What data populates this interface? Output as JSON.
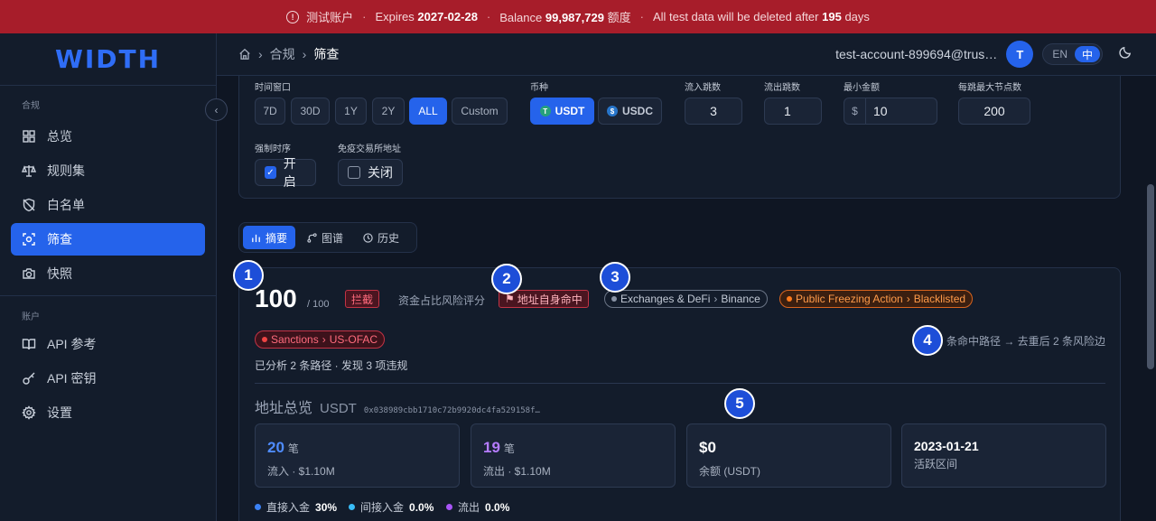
{
  "banner": {
    "account": "测试账户",
    "expires_label": "Expires",
    "expires_date": "2027-02-28",
    "balance_label": "Balance",
    "balance_value": "99,987,729",
    "balance_unit": "额度",
    "notice_prefix": "All test data will be deleted after",
    "notice_days": "195",
    "notice_suffix": "days"
  },
  "sidebar": {
    "logo": "WIDTH",
    "section1": "合规",
    "items": [
      {
        "label": "总览",
        "icon": "grid-icon"
      },
      {
        "label": "规则集",
        "icon": "scale-icon"
      },
      {
        "label": "白名单",
        "icon": "shield-off-icon"
      },
      {
        "label": "筛查",
        "icon": "scan-icon"
      },
      {
        "label": "快照",
        "icon": "camera-icon"
      }
    ],
    "section2": "账户",
    "items2": [
      {
        "label": "API 参考",
        "icon": "book-icon"
      },
      {
        "label": "API 密钥",
        "icon": "key-icon"
      },
      {
        "label": "设置",
        "icon": "gear-icon"
      }
    ]
  },
  "header": {
    "breadcrumb": [
      "合规",
      "筛查"
    ],
    "email": "test-account-899694@trus…",
    "avatar": "T",
    "lang_en": "EN",
    "lang_zh": "中"
  },
  "filters": {
    "time_label": "时间窗口",
    "time_options": [
      "7D",
      "30D",
      "1Y",
      "2Y",
      "ALL",
      "Custom"
    ],
    "time_selected": "ALL",
    "coin_label": "币种",
    "coins": [
      "USDT",
      "USDC"
    ],
    "coin_selected": "USDT",
    "in_hops_label": "流入跳数",
    "in_hops": "3",
    "out_hops_label": "流出跳数",
    "out_hops": "1",
    "min_amount_label": "最小金额",
    "min_amount_prefix": "$",
    "min_amount": "10",
    "max_nodes_label": "每跳最大节点数",
    "max_nodes": "200",
    "force_order_label": "强制时序",
    "force_order_value": "开启",
    "force_order_checked": true,
    "exempt_label": "免疫交易所地址",
    "exempt_value": "关闭",
    "exempt_checked": false
  },
  "tabs": [
    "摘要",
    "图谱",
    "历史"
  ],
  "result": {
    "score": "100",
    "score_of": "/ 100",
    "block_tag": "拦截",
    "risk_label": "资金占比风险评分",
    "hit_tag": "地址自身命中",
    "pill_exchange_a": "Exchanges & DeFi",
    "pill_exchange_b": "Binance",
    "pill_freeze_a": "Public Freezing Action",
    "pill_freeze_b": "Blacklisted",
    "pill_sanction_a": "Sanctions",
    "pill_sanction_b": "US-OFAC",
    "paths_note": "条命中路径 → 去重后 2 条风险边",
    "analyzed": "已分析 2 条路径 · 发现 3 项违规",
    "overview_title": "地址总览",
    "overview_coin": "USDT",
    "overview_addr": "0x038989cbb1710c72b9920dc4fa529158f…",
    "stats": [
      {
        "big": "20",
        "unit": "笔",
        "sub": "流入 · $1.10M",
        "color": "#4f8cff"
      },
      {
        "big": "19",
        "unit": "笔",
        "sub": "流出 · $1.10M",
        "color": "#b57cff"
      },
      {
        "big": "$0",
        "unit": "",
        "sub": "余额 (USDT)",
        "color": "#ffffff"
      },
      {
        "big": "2023-01-21",
        "unit": "",
        "sub": "活跃区间",
        "color": "#ffffff"
      }
    ],
    "legend": [
      {
        "label": "直接入金",
        "value": "30%",
        "color": "#3b82f6"
      },
      {
        "label": "间接入金",
        "value": "0.0%",
        "color": "#38bdf8"
      },
      {
        "label": "流出",
        "value": "0.0%",
        "color": "#a855f7"
      }
    ]
  },
  "markers": [
    "1",
    "2",
    "3",
    "4",
    "5"
  ]
}
